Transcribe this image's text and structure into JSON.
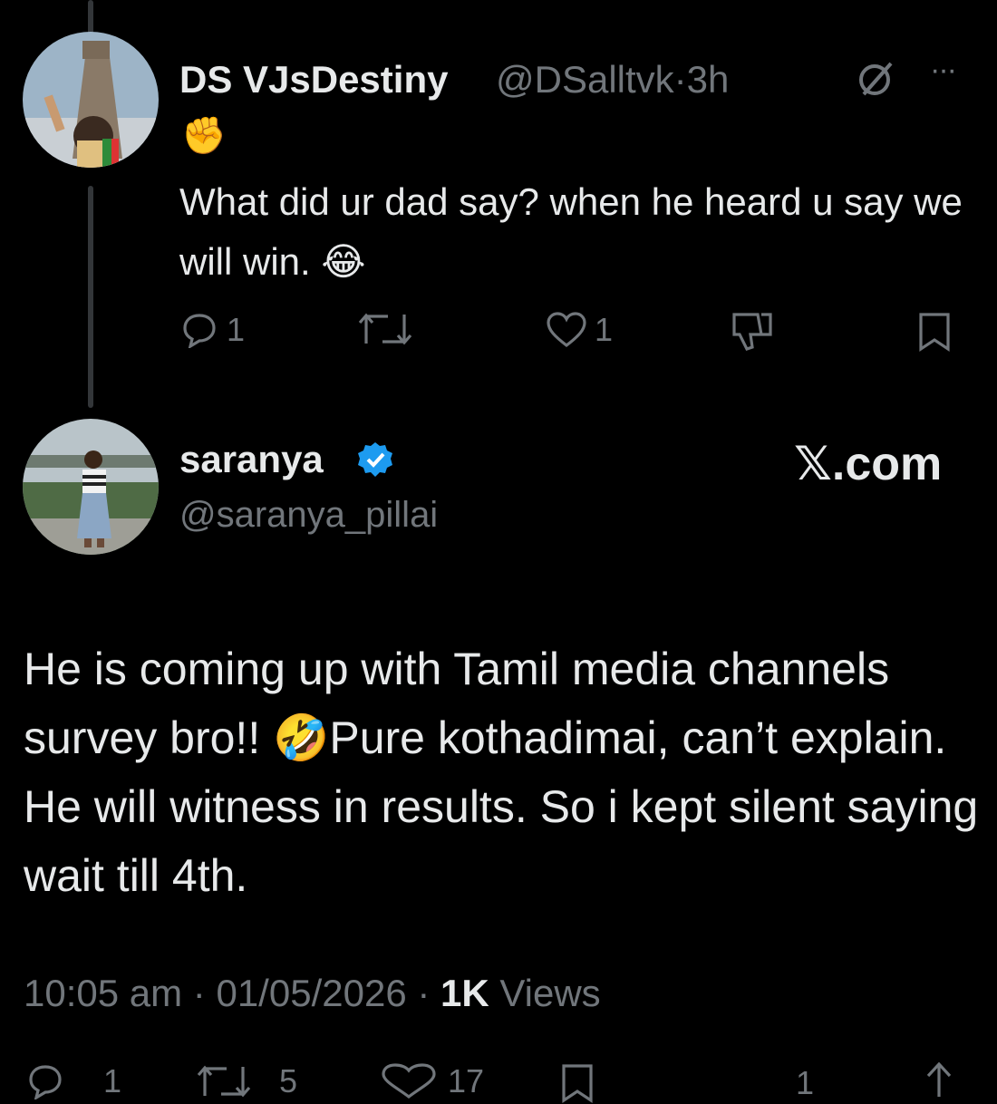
{
  "reply": {
    "display_name": "DS VJsDestiny",
    "handle": "@DSalltvk",
    "separator": "·",
    "time_ago": "3h",
    "more_icon": "···",
    "emoji_line": "✊",
    "text": "What did ur dad say? when he heard u say we will win. 😂",
    "actions": {
      "reply_count": "1",
      "repost_count": "",
      "like_count": "1"
    }
  },
  "main_post": {
    "display_name": "saranya",
    "handle": "@saranya_pillai",
    "brand": "𝕏.com",
    "text": "He is coming up with Tamil media channels survey bro!! 🤣Pure kothadimai, can’t  explain. He will witness in results. So i kept silent saying wait till 4th.",
    "time": "10:05 am",
    "date": "01/05/2026",
    "views_count": "1K",
    "views_label": "Views",
    "separator": "·"
  },
  "bottom_actions": {
    "reply_count": "1",
    "repost_count": "5",
    "like_count": "17",
    "bookmark_count": "1"
  },
  "colors": {
    "background": "#000000",
    "text": "#e7e9ea",
    "muted": "#71767b",
    "verified": "#1d9bf0",
    "thread_line": "#333639"
  }
}
